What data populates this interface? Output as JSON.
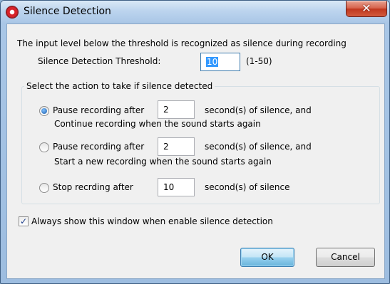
{
  "window": {
    "title": "Silence Detection",
    "close_glyph": "✕"
  },
  "threshold": {
    "description": "The input level below the threshold is recognized as silence during recording",
    "label": "Silence Detection Threshold:",
    "value": "10",
    "range_hint": "(1-50)"
  },
  "action_group": {
    "legend": "Select the action to take if silence detected",
    "options": [
      {
        "label": "Pause recording after",
        "value": "2",
        "suffix": "second(s) of silence, and",
        "note": "Continue recording when the sound starts again",
        "selected": true
      },
      {
        "label": "Pause recording after",
        "value": "2",
        "suffix": "second(s) of silence, and",
        "note": "Start a new recording when the sound starts again",
        "selected": false
      },
      {
        "label": "Stop recrding after",
        "value": "10",
        "suffix": "second(s) of silence",
        "selected": false
      }
    ]
  },
  "always_show": {
    "label": "Always show this window when enable silence detection",
    "checked": true,
    "check_glyph": "✓"
  },
  "buttons": {
    "ok": "OK",
    "cancel": "Cancel"
  },
  "icons": {
    "app": "record-icon",
    "close": "close-icon"
  }
}
